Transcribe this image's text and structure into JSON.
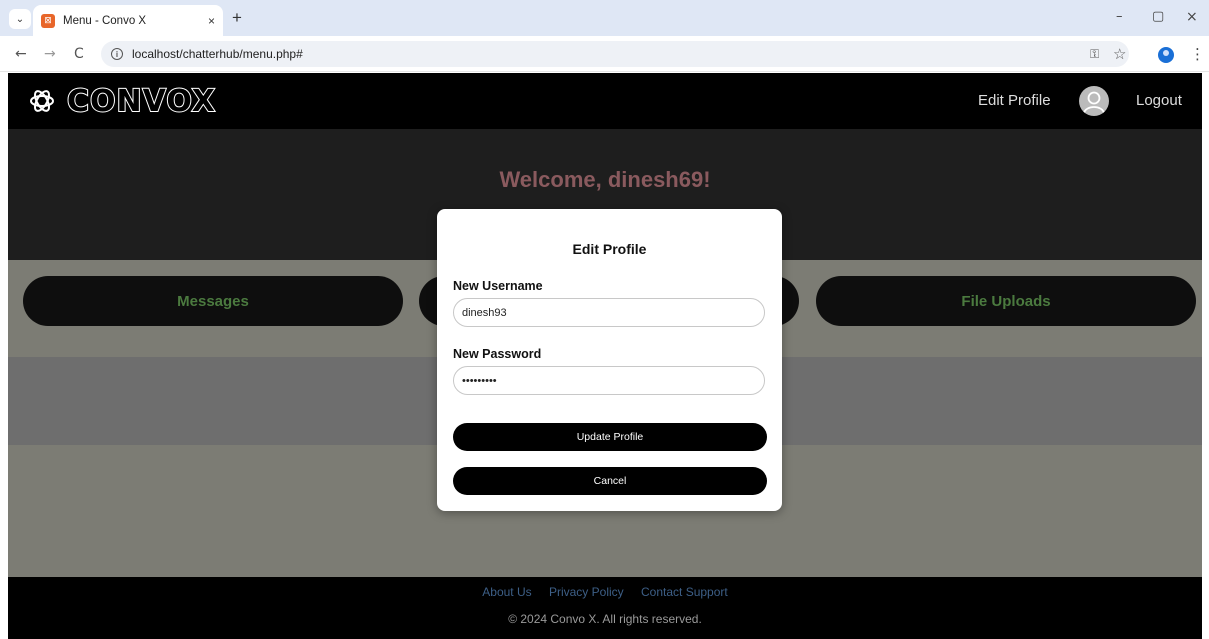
{
  "browser": {
    "tab_title": "Menu - Convo X",
    "favicon_glyph": "⊠",
    "tab_close": "×",
    "new_tab": "+",
    "url": "localhost/chatterhub/menu.php#",
    "window_controls": {
      "minimize": "–",
      "restore": "▢",
      "close": "×"
    },
    "nav": {
      "back": "←",
      "forward": "→",
      "reload": "C"
    },
    "icons": {
      "key": "key-icon",
      "star": "star-icon",
      "profile": "profile-icon",
      "menu": "kebab-menu-icon"
    }
  },
  "header": {
    "logo_text": "CONVOX",
    "logo_text_part1": "CONVO",
    "logo_text_part2": "X",
    "nav_edit_profile": "Edit Profile",
    "nav_logout": "Logout"
  },
  "welcome": {
    "text": "Welcome, dinesh69!"
  },
  "menu_buttons": [
    {
      "label": "Messages"
    },
    {
      "label": ""
    },
    {
      "label": "File Uploads"
    }
  ],
  "footer": {
    "links": [
      "About Us",
      "Privacy Policy",
      "Contact Support"
    ],
    "copyright": "© 2024 Convo X. All rights reserved."
  },
  "modal": {
    "title": "Edit Profile",
    "username_label": "New Username",
    "username_value": "dinesh93",
    "password_label": "New Password",
    "password_value": "dinesh123",
    "update_label": "Update Profile",
    "cancel_label": "Cancel"
  },
  "colors": {
    "header_bg": "#000000",
    "welcome_band_bg": "#1e1e1e",
    "welcome_text": "#8a5a5e",
    "main_bg": "#7c7c74",
    "pill_text": "#4b7a3f",
    "footer_link": "#3d5f87"
  }
}
